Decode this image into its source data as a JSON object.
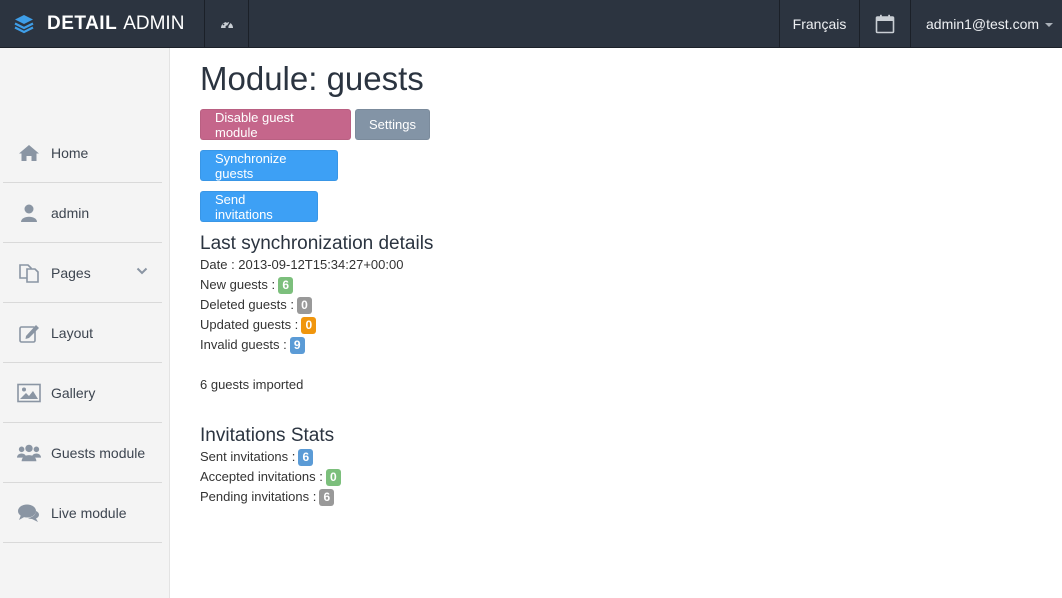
{
  "navbar": {
    "brand_bold": "DETAIL",
    "brand_light": "ADMIN",
    "language": "Français",
    "user": "admin1@test.com"
  },
  "sidebar": {
    "items": [
      {
        "label": "Home",
        "icon": "home-icon"
      },
      {
        "label": "admin",
        "icon": "user-icon"
      },
      {
        "label": "Pages",
        "icon": "pages-icon"
      },
      {
        "label": "Layout",
        "icon": "edit-icon"
      },
      {
        "label": "Gallery",
        "icon": "image-icon"
      },
      {
        "label": "Guests module",
        "icon": "group-icon"
      },
      {
        "label": "Live module",
        "icon": "comments-icon"
      }
    ]
  },
  "main": {
    "title": "Module: guests",
    "buttons": {
      "disable": "Disable guest module",
      "settings": "Settings",
      "sync": "Synchronize guests",
      "send": "Send invitations"
    },
    "sync": {
      "heading": "Last synchronization details",
      "date_label": "Date : 2013-09-12T15:34:27+00:00",
      "new_label": "New guests :",
      "new_value": "6",
      "deleted_label": "Deleted guests :",
      "deleted_value": "0",
      "updated_label": "Updated guests :",
      "updated_value": "0",
      "invalid_label": "Invalid guests :",
      "invalid_value": "9",
      "imported": "6 guests imported"
    },
    "invitations": {
      "heading": "Invitations Stats",
      "sent_label": "Sent invitations :",
      "sent_value": "6",
      "accepted_label": "Accepted invitations :",
      "accepted_value": "0",
      "pending_label": "Pending invitations :",
      "pending_value": "6"
    }
  },
  "colors": {
    "navbar": "#2c3440",
    "danger": "#c5668b",
    "grey": "#8394a6",
    "primary": "#3da0f5",
    "badge_green": "#7cbf7c",
    "badge_grey": "#999999",
    "badge_orange": "#f0960e",
    "badge_blue": "#5b9bd6"
  }
}
